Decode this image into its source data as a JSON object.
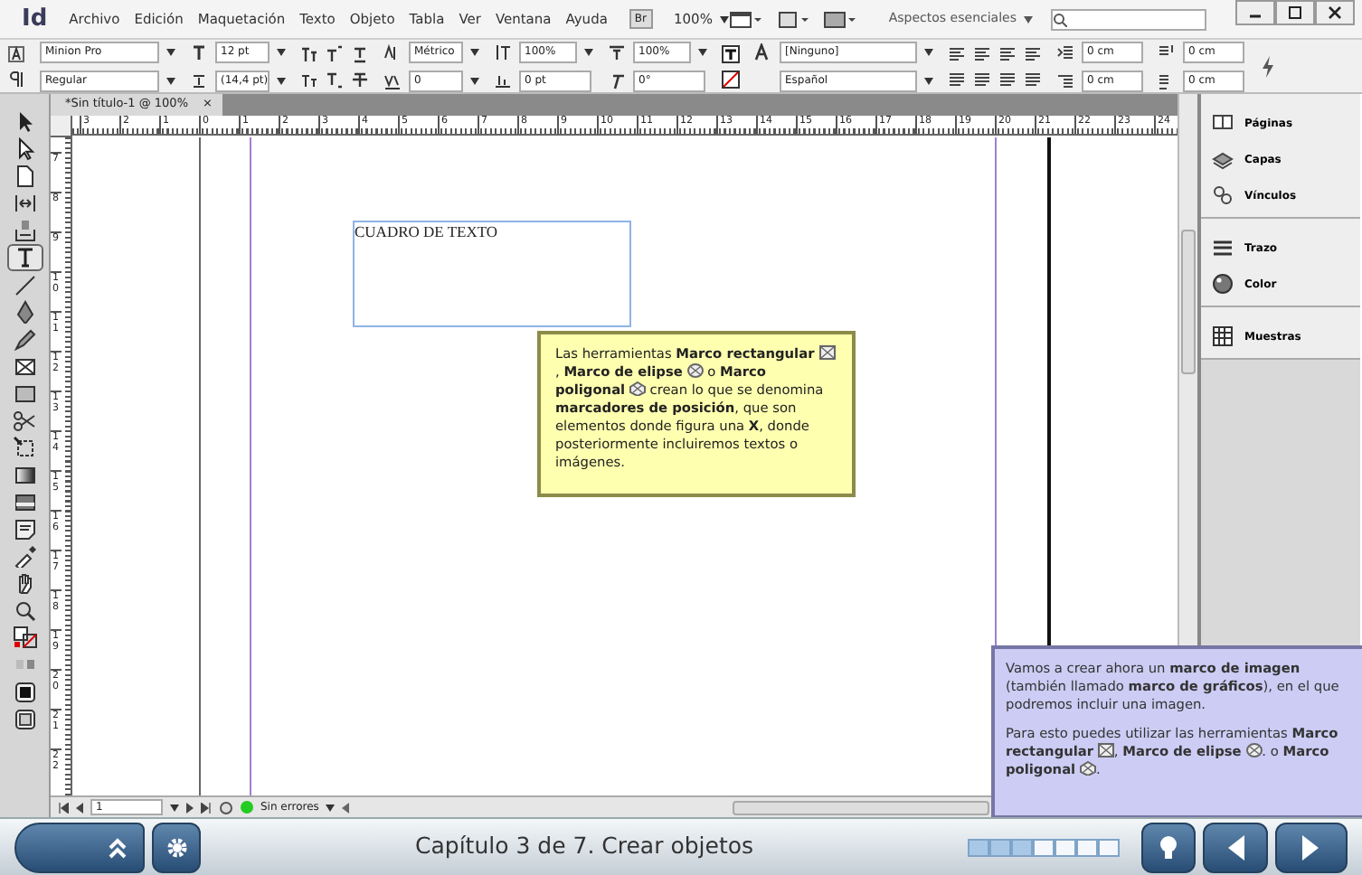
{
  "menubar": {
    "logo": "Id",
    "items": [
      "Archivo",
      "Edición",
      "Maquetación",
      "Texto",
      "Objeto",
      "Tabla",
      "Ver",
      "Ventana",
      "Ayuda"
    ],
    "bridge": "Br",
    "zoom": "100%",
    "workspace": "Aspectos esenciales",
    "window_buttons": [
      {
        "kind": "minimize"
      },
      {
        "kind": "maximize"
      },
      {
        "kind": "close"
      }
    ]
  },
  "control_panel": {
    "font": "Minion Pro",
    "style": "Regular",
    "size": "12 pt",
    "leading": "(14,4 pt)",
    "kerning": "Métrico",
    "tracking": "0",
    "vscale": "100%",
    "baseline": "0 pt",
    "hscale": "100%",
    "skew": "0°",
    "char_style": "[Ninguno]",
    "language": "Español",
    "indents": [
      "0 cm",
      "0 cm",
      "0 cm",
      "0 cm"
    ]
  },
  "document_tab": {
    "title": "*Sin título-1 @ 100%",
    "close": "×"
  },
  "ruler": {
    "horizontal": [
      "3",
      "2",
      "1",
      "0",
      "1",
      "2",
      "3",
      "4",
      "5",
      "6",
      "7",
      "8",
      "9",
      "10",
      "11",
      "12",
      "13",
      "14",
      "15",
      "16",
      "17",
      "18",
      "19",
      "20",
      "21",
      "22",
      "23",
      "24"
    ],
    "vertical": [
      "7",
      "8",
      "9",
      "10",
      "11",
      "12",
      "13",
      "14",
      "15",
      "16",
      "17",
      "18",
      "19",
      "20",
      "21",
      "22"
    ]
  },
  "text_frame": "CUADRO DE TEXTO",
  "tools": [
    {
      "kind": "selection",
      "selected": false
    },
    {
      "kind": "direct",
      "selected": false
    },
    {
      "kind": "page",
      "selected": false
    },
    {
      "kind": "gap",
      "selected": false
    },
    {
      "kind": "collector",
      "selected": false
    },
    {
      "kind": "type",
      "selected": true
    },
    {
      "kind": "line",
      "selected": false
    },
    {
      "kind": "pen",
      "selected": false
    },
    {
      "kind": "pencil",
      "selected": false
    },
    {
      "kind": "frame",
      "selected": false
    },
    {
      "kind": "rectangle",
      "selected": false
    },
    {
      "kind": "scissors",
      "selected": false
    },
    {
      "kind": "transform",
      "selected": false
    },
    {
      "kind": "gradient",
      "selected": false
    },
    {
      "kind": "feather",
      "selected": false
    },
    {
      "kind": "note",
      "selected": false
    },
    {
      "kind": "eyedropper",
      "selected": false
    },
    {
      "kind": "hand",
      "selected": false
    },
    {
      "kind": "zoom",
      "selected": false
    },
    {
      "kind": "fillstroke",
      "selected": false
    },
    {
      "kind": "mode",
      "selected": false
    },
    {
      "kind": "view",
      "selected": false
    },
    {
      "kind": "screen",
      "selected": false
    }
  ],
  "status_bar": {
    "page": "1",
    "preflight": "Sin errores"
  },
  "panels": [
    [
      {
        "kind": "pages",
        "label": "Páginas"
      },
      {
        "kind": "layers",
        "label": "Capas"
      },
      {
        "kind": "links",
        "label": "Vínculos"
      }
    ],
    [
      {
        "kind": "stroke",
        "label": "Trazo"
      },
      {
        "kind": "color",
        "label": "Color"
      }
    ],
    [
      {
        "kind": "swatches",
        "label": "Muestras"
      }
    ]
  ],
  "callouts": [
    {
      "kind": "note",
      "paragraphs": [
        [
          {
            "kind": "text",
            "text": "Las herramientas **Marco rectangular** "
          },
          {
            "kind": "rect-frame"
          },
          {
            "kind": "text",
            "text": ", **Marco de elipse** "
          },
          {
            "kind": "ellipse-frame"
          },
          {
            "kind": "text",
            "text": " o **Marco poligonal** "
          },
          {
            "kind": "polygon-frame"
          },
          {
            "kind": "text",
            "text": " crean lo que se denomina **marcadores de posición**, que son elementos donde figura una **X**, donde posteriormente incluiremos textos o imágenes."
          }
        ]
      ]
    },
    {
      "kind": "info",
      "paragraphs": [
        [
          {
            "kind": "text",
            "text": "Vamos a crear ahora un **marco de imagen** (también llamado **marco de gráficos**), en el que podremos incluir una imagen."
          }
        ],
        [
          {
            "kind": "text",
            "text": "Para esto puedes utilizar las herramientas **Marco rectangular** "
          },
          {
            "kind": "rect-frame"
          },
          {
            "kind": "text",
            "text": ", **Marco de elipse** "
          },
          {
            "kind": "ellipse-frame"
          },
          {
            "kind": "text",
            "text": ". o **Marco poligonal** "
          },
          {
            "kind": "polygon-frame"
          },
          {
            "kind": "text",
            "text": "."
          }
        ]
      ]
    }
  ],
  "nav": {
    "chapter": "Capítulo 3 de 7. Crear objetos",
    "steps": [
      {
        "done": true
      },
      {
        "done": true
      },
      {
        "done": true
      },
      {
        "done": false
      },
      {
        "done": false
      },
      {
        "done": false
      },
      {
        "done": false
      }
    ]
  }
}
